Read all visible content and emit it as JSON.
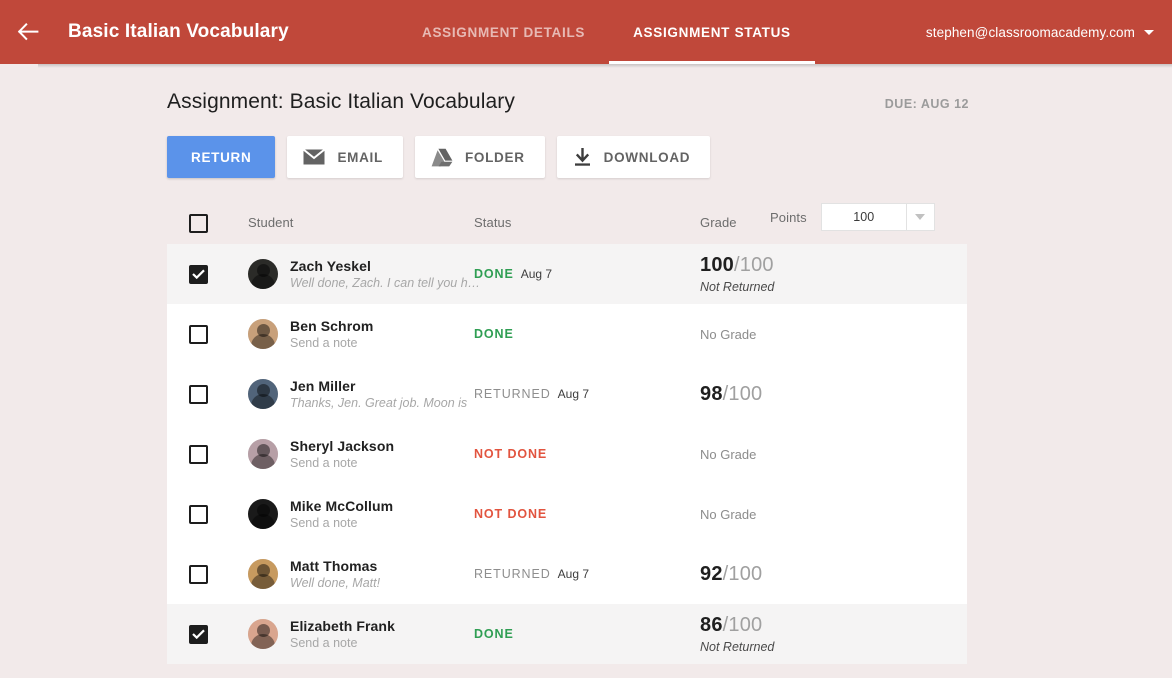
{
  "appbar": {
    "back_icon": "arrow-left-icon",
    "title": "Basic Italian Vocabulary",
    "tabs": [
      {
        "label": "ASSIGNMENT DETAILS",
        "active": false
      },
      {
        "label": "ASSIGNMENT STATUS",
        "active": true
      }
    ],
    "account_email": "stephen@classroomacademy.com",
    "bg_color": "#c0483a"
  },
  "page": {
    "assignment_title": "Assignment: Basic Italian Vocabulary",
    "due_label": "DUE: AUG 12",
    "background_color": "#f2eaea"
  },
  "toolbar": {
    "return_label": "RETURN",
    "email_label": "EMAIL",
    "folder_label": "FOLDER",
    "download_label": "DOWNLOAD",
    "primary_color": "#5b93ea"
  },
  "table": {
    "headers": {
      "student": "Student",
      "status": "Status",
      "grade": "Grade",
      "points": "Points"
    },
    "points_value": "100",
    "header_checked": false,
    "rows": [
      {
        "checked": true,
        "selected": true,
        "name": "Zach Yeskel",
        "note": "Well done, Zach. I can tell you have",
        "note_is_placeholder": false,
        "status": "DONE",
        "status_kind": "done",
        "status_date": "Aug 7",
        "grade": "100",
        "grade_total": "/100",
        "grade_none": "",
        "grade_sub": "Not Returned",
        "avatar_color": "#2b2b28"
      },
      {
        "checked": false,
        "selected": false,
        "name": "Ben Schrom",
        "note": "Send a note",
        "note_is_placeholder": true,
        "status": "DONE",
        "status_kind": "done",
        "status_date": "",
        "grade": "",
        "grade_total": "",
        "grade_none": "No Grade",
        "grade_sub": "",
        "avatar_color": "#c8a07a"
      },
      {
        "checked": false,
        "selected": false,
        "name": "Jen Miller",
        "note": "Thanks, Jen. Great job. Moon is",
        "note_is_placeholder": false,
        "status": "RETURNED",
        "status_kind": "returned",
        "status_date": "Aug 7",
        "grade": "98",
        "grade_total": "/100",
        "grade_none": "",
        "grade_sub": "",
        "avatar_color": "#51647a"
      },
      {
        "checked": false,
        "selected": false,
        "name": "Sheryl Jackson",
        "note": "Send a note",
        "note_is_placeholder": true,
        "status": "NOT DONE",
        "status_kind": "notdone",
        "status_date": "",
        "grade": "",
        "grade_total": "",
        "grade_none": "No Grade",
        "grade_sub": "",
        "avatar_color": "#b79fa6"
      },
      {
        "checked": false,
        "selected": false,
        "name": "Mike McCollum",
        "note": "Send a note",
        "note_is_placeholder": true,
        "status": "NOT DONE",
        "status_kind": "notdone",
        "status_date": "",
        "grade": "",
        "grade_total": "",
        "grade_none": "No Grade",
        "grade_sub": "",
        "avatar_color": "#1a1a1a"
      },
      {
        "checked": false,
        "selected": false,
        "name": "Matt Thomas",
        "note": "Well done, Matt!",
        "note_is_placeholder": false,
        "status": "RETURNED",
        "status_kind": "returned",
        "status_date": "Aug 7",
        "grade": "92",
        "grade_total": "/100",
        "grade_none": "",
        "grade_sub": "",
        "avatar_color": "#c79a5f"
      },
      {
        "checked": true,
        "selected": true,
        "name": "Elizabeth Frank",
        "note": "Send a note",
        "note_is_placeholder": true,
        "status": "DONE",
        "status_kind": "done",
        "status_date": "",
        "grade": "86",
        "grade_total": "/100",
        "grade_none": "",
        "grade_sub": "Not Returned",
        "avatar_color": "#d9a58e"
      }
    ]
  }
}
